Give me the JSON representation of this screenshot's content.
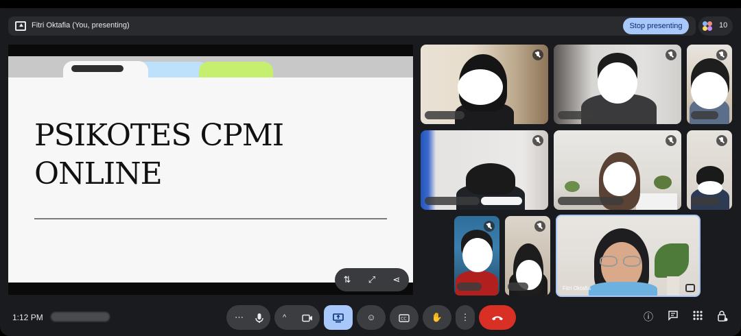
{
  "header": {
    "presenter_label": "Fitri Oktafia (You, presenting)",
    "stop_presenting_label": "Stop presenting",
    "participant_count": "10"
  },
  "slide": {
    "title": "PSIKOTES CPMI\nONLINE",
    "tools": [
      "swap-icon",
      "fullscreen-icon",
      "share-icon"
    ]
  },
  "tiles": {
    "self_name": "Fitri Oktafia"
  },
  "bottom_bar": {
    "time": "1:12 PM",
    "controls": [
      {
        "name": "more-options-button",
        "icon": "dots-horizontal-icon"
      },
      {
        "name": "microphone-button",
        "icon": "mic-icon"
      },
      {
        "name": "camera-options-button",
        "icon": "chevron-up-icon"
      },
      {
        "name": "camera-button",
        "icon": "video-icon"
      },
      {
        "name": "present-button",
        "icon": "present-screen-icon"
      },
      {
        "name": "reactions-button",
        "icon": "emoji-icon"
      },
      {
        "name": "captions-button",
        "icon": "cc-icon"
      },
      {
        "name": "raise-hand-button",
        "icon": "hand-icon"
      },
      {
        "name": "more-actions-button",
        "icon": "dots-vertical-icon"
      },
      {
        "name": "end-call-button",
        "icon": "hang-up-icon"
      }
    ],
    "right_icons": [
      "info-icon",
      "chat-icon",
      "activities-icon",
      "host-controls-icon"
    ]
  },
  "colors": {
    "accent": "#a8c7fa",
    "end_call": "#d93025",
    "background": "#1a1b1e"
  }
}
